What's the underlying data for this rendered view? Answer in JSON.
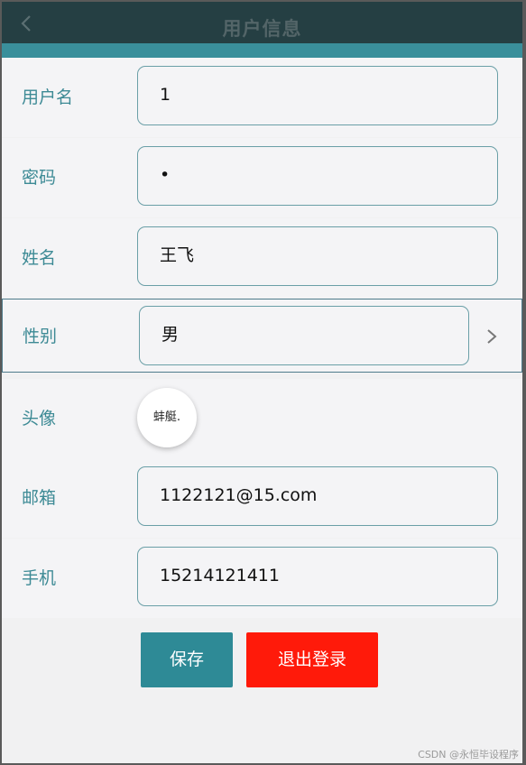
{
  "header": {
    "title": "用户信息",
    "back_icon": "chevron-left-icon"
  },
  "form": {
    "username": {
      "label": "用户名",
      "value": "1"
    },
    "password": {
      "label": "密码",
      "value": "•"
    },
    "name": {
      "label": "姓名",
      "value": "王飞"
    },
    "gender": {
      "label": "性别",
      "value": "男",
      "icon": "chevron-right-icon"
    },
    "avatar": {
      "label": "头像",
      "image_text": "蚌艇."
    },
    "email": {
      "label": "邮箱",
      "value": "1122121@15.com"
    },
    "phone": {
      "label": "手机",
      "value": "15214121411"
    }
  },
  "actions": {
    "save_label": "保存",
    "logout_label": "退出登录"
  },
  "watermark": "CSDN @永恒毕设程序",
  "colors": {
    "header_bg": "#253f43",
    "accent": "#3a8f9b",
    "label": "#3d8a95",
    "save_button": "#2e8a96",
    "logout_button": "#ff1a0a"
  }
}
